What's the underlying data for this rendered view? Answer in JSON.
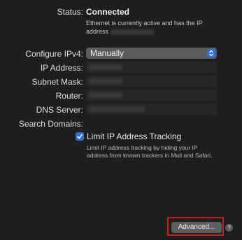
{
  "status": {
    "label": "Status:",
    "value": "Connected",
    "description": "Ethernet is currently active and has the IP address"
  },
  "configure_ipv4": {
    "label": "Configure IPv4:",
    "selected": "Manually"
  },
  "fields": {
    "ip_address_label": "IP Address:",
    "subnet_mask_label": "Subnet Mask:",
    "router_label": "Router:",
    "dns_server_label": "DNS Server:",
    "search_domains_label": "Search Domains:"
  },
  "limit_tracking": {
    "label": "Limit IP Address Tracking",
    "checked": true,
    "description": "Limit IP address tracking by hiding your IP address from known trackers in Mail and Safari."
  },
  "buttons": {
    "advanced": "Advanced...",
    "help": "?"
  },
  "colors": {
    "accent": "#2f6fe0",
    "highlight": "#d11b1b"
  }
}
